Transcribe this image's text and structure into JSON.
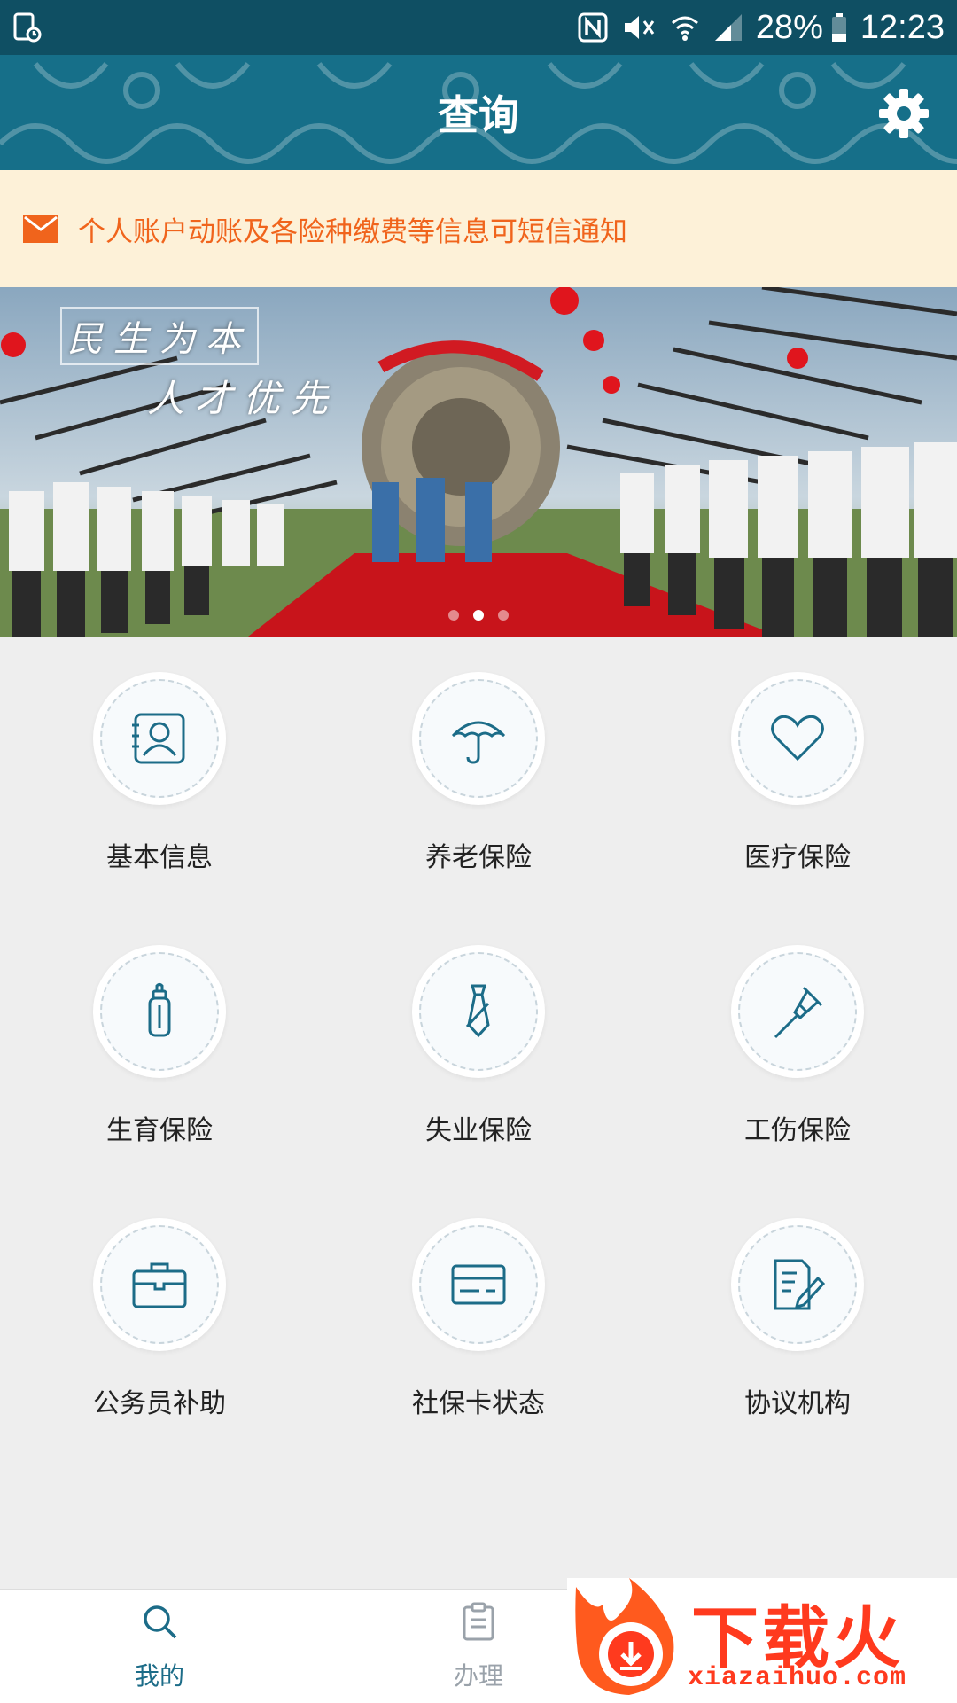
{
  "status_bar": {
    "battery": "28%",
    "time": "12:23"
  },
  "header": {
    "title": "查询"
  },
  "notice": {
    "text": "个人账户动账及各险种缴费等信息可短信通知"
  },
  "banner": {
    "caption_1": "民生为本",
    "caption_2": "人才优先"
  },
  "grid": [
    {
      "label": "基本信息",
      "icon": "id-card-icon"
    },
    {
      "label": "养老保险",
      "icon": "umbrella-icon"
    },
    {
      "label": "医疗保险",
      "icon": "heart-icon"
    },
    {
      "label": "生育保险",
      "icon": "baby-bottle-icon"
    },
    {
      "label": "失业保险",
      "icon": "necktie-icon"
    },
    {
      "label": "工伤保险",
      "icon": "crutch-icon"
    },
    {
      "label": "公务员补助",
      "icon": "briefcase-icon"
    },
    {
      "label": "社保卡状态",
      "icon": "card-icon"
    },
    {
      "label": "协议机构",
      "icon": "document-pen-icon"
    }
  ],
  "bottom_nav": {
    "my": "我的",
    "handle": "办理"
  },
  "watermark": {
    "title": "下载火",
    "url": "xiazaihuo.com"
  },
  "colors": {
    "accent": "#1c6c88",
    "notice_text": "#f0641c",
    "watermark": "#ff3a1e"
  }
}
